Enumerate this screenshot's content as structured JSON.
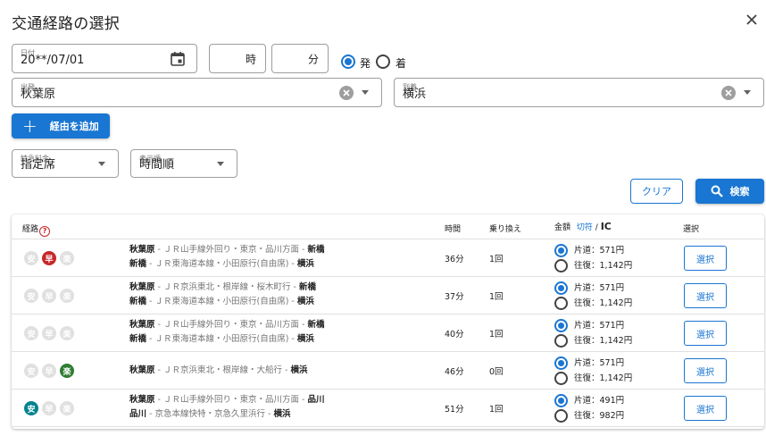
{
  "dialog": {
    "title": "交通経路の選択"
  },
  "form": {
    "date": {
      "label": "日付",
      "value": "20**/07/01"
    },
    "hour": {
      "suffix": "時"
    },
    "minute": {
      "suffix": "分"
    },
    "time_mode": {
      "options": [
        "発",
        "着"
      ],
      "selected": "発"
    },
    "departure": {
      "label": "出発",
      "value": "秋葉原"
    },
    "arrival": {
      "label": "到着",
      "value": "横浜"
    },
    "add_route_label": "経由を追加",
    "express": {
      "label": "特急料金",
      "value": "指定席"
    },
    "order": {
      "label": "表示順",
      "value": "時間順"
    },
    "clear_label": "クリア",
    "search_label": "検索"
  },
  "table": {
    "headers": {
      "route": "経路",
      "help": "?",
      "time": "時間",
      "transfer": "乗り換え",
      "fare": "金額",
      "ticket": "切符",
      "slash": "/",
      "ic": "IC",
      "select": "選択"
    },
    "badge_labels": [
      "安",
      "早",
      "楽"
    ],
    "rows": [
      {
        "badges": [
          false,
          true,
          false
        ],
        "lines": [
          [
            "秋葉原",
            "ＪＲ山手線外回り・東京・品川方面",
            "新橋"
          ],
          [
            "新橋",
            "ＪＲ東海道本線・小田原行(自由席)",
            "横浜"
          ]
        ],
        "time": "36分",
        "transfer": "1回",
        "fare_oneway": "片道：571円",
        "fare_round": "往復：1,142円",
        "select_label": "選択"
      },
      {
        "badges": [
          false,
          false,
          false
        ],
        "lines": [
          [
            "秋葉原",
            "ＪＲ京浜東北・根岸線・桜木町行",
            "新橋"
          ],
          [
            "新橋",
            "ＪＲ東海道本線・小田原行(自由席)",
            "横浜"
          ]
        ],
        "time": "37分",
        "transfer": "1回",
        "fare_oneway": "片道：571円",
        "fare_round": "往復：1,142円",
        "select_label": "選択"
      },
      {
        "badges": [
          false,
          false,
          false
        ],
        "lines": [
          [
            "秋葉原",
            "ＪＲ山手線外回り・東京・品川方面",
            "新橋"
          ],
          [
            "新橋",
            "ＪＲ東海道本線・小田原行(自由席)",
            "横浜"
          ]
        ],
        "time": "40分",
        "transfer": "1回",
        "fare_oneway": "片道：571円",
        "fare_round": "往復：1,142円",
        "select_label": "選択"
      },
      {
        "badges": [
          false,
          false,
          true
        ],
        "lines": [
          [
            "秋葉原",
            "ＪＲ京浜東北・根岸線・大船行",
            "横浜"
          ]
        ],
        "time": "46分",
        "transfer": "0回",
        "fare_oneway": "片道：571円",
        "fare_round": "往復：1,142円",
        "select_label": "選択"
      },
      {
        "badges": [
          true,
          false,
          false
        ],
        "lines": [
          [
            "秋葉原",
            "ＪＲ山手線外回り・東京・品川方面",
            "品川"
          ],
          [
            "品川",
            "京急本線快特・京急久里浜行",
            "横浜"
          ]
        ],
        "time": "51分",
        "transfer": "1回",
        "fare_oneway": "片道：491円",
        "fare_round": "往復：982円",
        "select_label": "選択"
      }
    ]
  },
  "colors": {
    "accent": "#1976d2",
    "safe": "#00838f",
    "fast": "#c62828",
    "easy": "#2e7d32",
    "badge_off": "#e0e0e0"
  }
}
